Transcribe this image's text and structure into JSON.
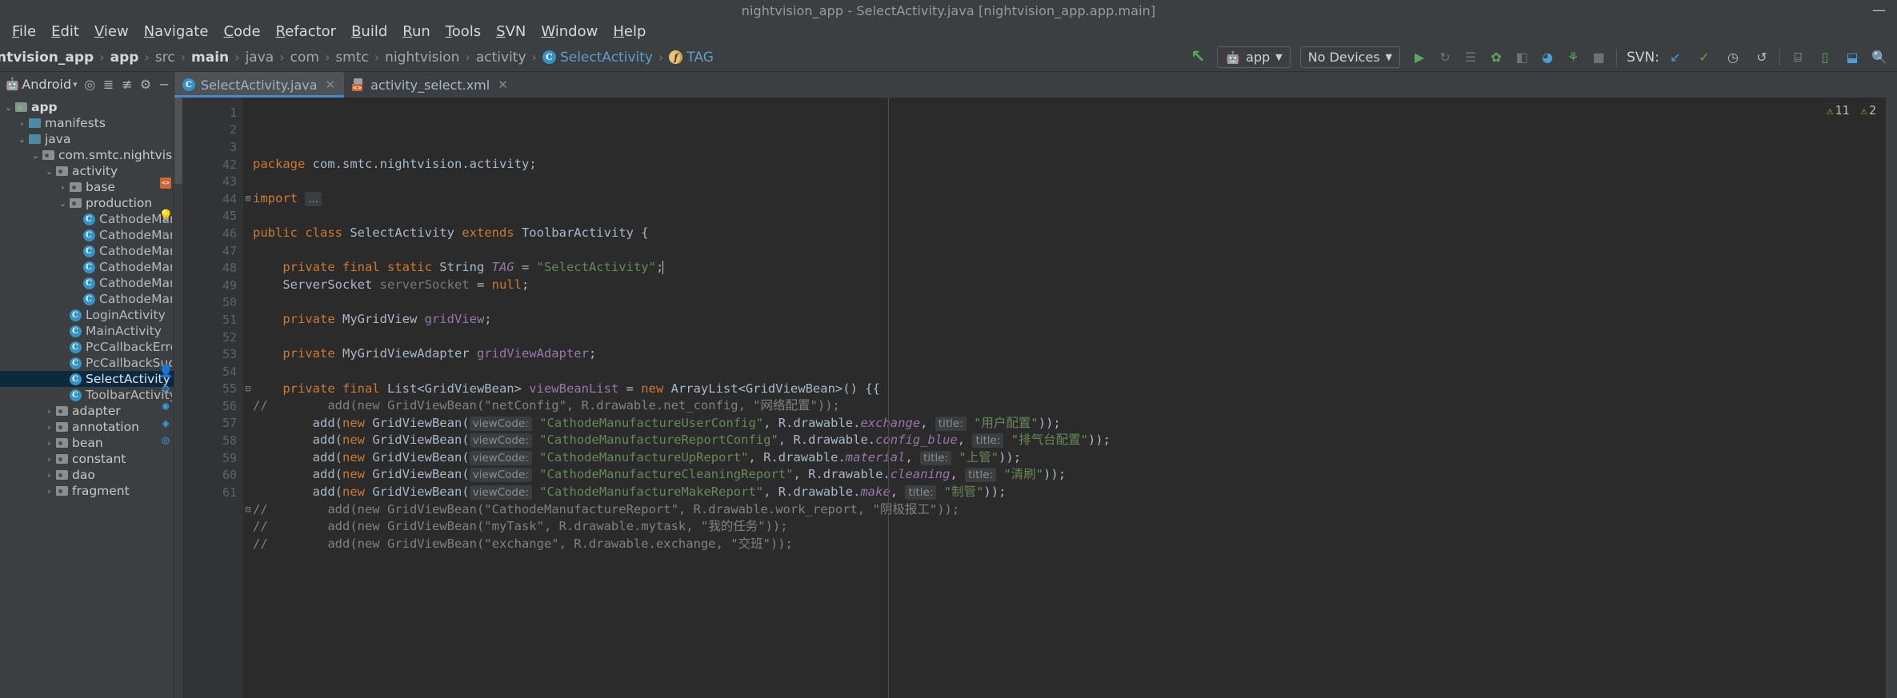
{
  "window": {
    "title": "nightvision_app - SelectActivity.java [nightvision_app.app.main]",
    "minimize": "—",
    "maximize": "❐",
    "close": "✕"
  },
  "menubar": {
    "items": [
      "File",
      "Edit",
      "View",
      "Navigate",
      "Code",
      "Refactor",
      "Build",
      "Run",
      "Tools",
      "SVN",
      "Window",
      "Help"
    ]
  },
  "breadcrumb": {
    "items": [
      {
        "label": "ntvision_app",
        "style": "bold"
      },
      {
        "label": "app",
        "style": "bold"
      },
      {
        "label": "src",
        "style": "normal"
      },
      {
        "label": "main",
        "style": "bold"
      },
      {
        "label": "java",
        "style": "normal"
      },
      {
        "label": "com",
        "style": "normal"
      },
      {
        "label": "smtc",
        "style": "normal"
      },
      {
        "label": "nightvision",
        "style": "normal"
      },
      {
        "label": "activity",
        "style": "normal"
      },
      {
        "label": "SelectActivity",
        "style": "link",
        "icon": "class-icon"
      },
      {
        "label": "TAG",
        "style": "link",
        "icon": "field-icon"
      }
    ],
    "separator": "›"
  },
  "toolbar": {
    "back_arrow": "↖",
    "run_config": {
      "label": "app",
      "icon": "android-icon",
      "caret": "▼"
    },
    "device_select": {
      "label": "No Devices",
      "caret": "▼"
    },
    "buttons": [
      {
        "name": "run-button",
        "glyph": "▶",
        "color": "#5ca75c"
      },
      {
        "name": "apply-changes-icon",
        "glyph": "↻",
        "color": "#6f7072"
      },
      {
        "name": "apply-code-changes-icon",
        "glyph": "☰",
        "color": "#6f7072"
      },
      {
        "name": "debug-icon",
        "glyph": "✿",
        "color": "#5ca75c"
      },
      {
        "name": "attach-debugger-icon",
        "glyph": "◧",
        "color": "#6f7072"
      },
      {
        "name": "profiler-icon",
        "glyph": "◕",
        "color": "#4a9fd4"
      },
      {
        "name": "run-with-coverage-icon",
        "glyph": "⚘",
        "color": "#5ca75c"
      },
      {
        "name": "stop-icon",
        "glyph": "■",
        "color": "#6f7072"
      }
    ],
    "svn_label": "SVN:",
    "svn_buttons": [
      {
        "name": "svn-update-icon",
        "glyph": "↙",
        "color": "#4a9fd4"
      },
      {
        "name": "svn-commit-icon",
        "glyph": "✓",
        "color": "#5ca75c"
      },
      {
        "name": "svn-history-icon",
        "glyph": "◷",
        "color": "#bbbbbb"
      },
      {
        "name": "svn-revert-icon",
        "glyph": "↺",
        "color": "#bbbbbb"
      }
    ],
    "right_buttons": [
      {
        "name": "avd-manager-icon",
        "glyph": "⌸",
        "color": "#a9b7c6"
      },
      {
        "name": "sdk-manager-icon",
        "glyph": "▯",
        "color": "#5ca75c"
      },
      {
        "name": "gradle-sync-icon",
        "glyph": "⬓",
        "color": "#4a9fd4"
      },
      {
        "name": "search-everywhere-icon",
        "glyph": "🔍",
        "color": "#a9b7c6"
      }
    ]
  },
  "sidebar": {
    "header": {
      "title": "Android",
      "caret": "▾",
      "icons": [
        "locate-icon",
        "collapse-all-icon",
        "expand-icon",
        "settings-icon",
        "hide-icon"
      ]
    },
    "tree": [
      {
        "indent": 0,
        "arrow": "⌄",
        "icon": "folder-module",
        "label": "app",
        "bold": true
      },
      {
        "indent": 1,
        "arrow": "›",
        "icon": "folder",
        "label": "manifests"
      },
      {
        "indent": 1,
        "arrow": "⌄",
        "icon": "folder",
        "label": "java"
      },
      {
        "indent": 2,
        "arrow": "⌄",
        "icon": "package",
        "label": "com.smtc.nightvision"
      },
      {
        "indent": 3,
        "arrow": "⌄",
        "icon": "package",
        "label": "activity"
      },
      {
        "indent": 4,
        "arrow": "›",
        "icon": "package",
        "label": "base"
      },
      {
        "indent": 4,
        "arrow": "⌄",
        "icon": "package",
        "label": "production"
      },
      {
        "indent": 5,
        "arrow": "",
        "icon": "class",
        "label": "CathodeManufac"
      },
      {
        "indent": 5,
        "arrow": "",
        "icon": "class",
        "label": "CathodeManufac"
      },
      {
        "indent": 5,
        "arrow": "",
        "icon": "class",
        "label": "CathodeManufac"
      },
      {
        "indent": 5,
        "arrow": "",
        "icon": "class",
        "label": "CathodeManufac"
      },
      {
        "indent": 5,
        "arrow": "",
        "icon": "class",
        "label": "CathodeManufac"
      },
      {
        "indent": 5,
        "arrow": "",
        "icon": "class",
        "label": "CathodeManufac"
      },
      {
        "indent": 4,
        "arrow": "",
        "icon": "class",
        "label": "LoginActivity"
      },
      {
        "indent": 4,
        "arrow": "",
        "icon": "class",
        "label": "MainActivity"
      },
      {
        "indent": 4,
        "arrow": "",
        "icon": "class",
        "label": "PcCallbackErrorActi"
      },
      {
        "indent": 4,
        "arrow": "",
        "icon": "class",
        "label": "PcCallbackSuccessA"
      },
      {
        "indent": 4,
        "arrow": "",
        "icon": "class",
        "label": "SelectActivity",
        "selected": true
      },
      {
        "indent": 4,
        "arrow": "",
        "icon": "class",
        "label": "ToolbarActivity"
      },
      {
        "indent": 3,
        "arrow": "›",
        "icon": "package",
        "label": "adapter"
      },
      {
        "indent": 3,
        "arrow": "›",
        "icon": "package",
        "label": "annotation"
      },
      {
        "indent": 3,
        "arrow": "›",
        "icon": "package",
        "label": "bean"
      },
      {
        "indent": 3,
        "arrow": "›",
        "icon": "package",
        "label": "constant"
      },
      {
        "indent": 3,
        "arrow": "›",
        "icon": "package",
        "label": "dao"
      },
      {
        "indent": 3,
        "arrow": "›",
        "icon": "package",
        "label": "fragment"
      }
    ]
  },
  "editor": {
    "tabs": [
      {
        "label": "SelectActivity.java",
        "icon": "java-class-icon",
        "active": true,
        "close": "✕"
      },
      {
        "label": "activity_select.xml",
        "icon": "xml-layout-icon",
        "active": false,
        "close": "✕"
      }
    ],
    "inspections": {
      "warnings": "11",
      "weak_warnings": "2",
      "warn_glyph": "⚠"
    },
    "line_numbers": [
      "1",
      "2",
      "3",
      "42",
      "43",
      "44",
      "45",
      "46",
      "47",
      "48",
      "49",
      "50",
      "51",
      "52",
      "53",
      "54",
      "55",
      "56",
      "57",
      "58",
      "59",
      "60",
      "61"
    ],
    "lines": [
      {
        "num": "1",
        "segments": [
          {
            "t": "package ",
            "c": "kw"
          },
          {
            "t": "com.smtc.nightvision.activity;",
            "c": "plain"
          }
        ]
      },
      {
        "num": "2",
        "segments": []
      },
      {
        "num": "3",
        "segments": [
          {
            "t": "import ",
            "c": "kw"
          },
          {
            "t": "...",
            "c": "hint-box"
          }
        ],
        "fold": "⊞"
      },
      {
        "num": "42",
        "segments": []
      },
      {
        "num": "43",
        "segments": [
          {
            "t": "public class ",
            "c": "kw"
          },
          {
            "t": "SelectActivity ",
            "c": "cls2"
          },
          {
            "t": "extends ",
            "c": "kw"
          },
          {
            "t": "ToolbarActivity {",
            "c": "cls2"
          }
        ],
        "gutter_icon": "layout-file-icon"
      },
      {
        "num": "44",
        "segments": []
      },
      {
        "num": "45",
        "segments": [
          {
            "t": "    ",
            "c": "plain"
          },
          {
            "t": "private final static ",
            "c": "kw"
          },
          {
            "t": "String ",
            "c": "cls2"
          },
          {
            "t": "TAG",
            "c": "stat"
          },
          {
            "t": " = ",
            "c": "plain"
          },
          {
            "t": "\"SelectActivity\"",
            "c": "str"
          },
          {
            "t": ";",
            "c": "plain"
          }
        ],
        "gutter_icon": "bulb-icon",
        "caret": true
      },
      {
        "num": "46",
        "segments": [
          {
            "t": "    ",
            "c": "plain"
          },
          {
            "t": "ServerSocket ",
            "c": "cls2"
          },
          {
            "t": "serverSocket",
            "c": "graytxt"
          },
          {
            "t": " = ",
            "c": "plain"
          },
          {
            "t": "null",
            "c": "kw"
          },
          {
            "t": ";",
            "c": "plain"
          }
        ],
        "gutter_icon": "run-arrow-icon"
      },
      {
        "num": "47",
        "segments": []
      },
      {
        "num": "48",
        "segments": [
          {
            "t": "    ",
            "c": "plain"
          },
          {
            "t": "private ",
            "c": "kw"
          },
          {
            "t": "MyGridView ",
            "c": "cls2"
          },
          {
            "t": "gridView",
            "c": "fld"
          },
          {
            "t": ";",
            "c": "plain"
          }
        ]
      },
      {
        "num": "49",
        "segments": []
      },
      {
        "num": "50",
        "segments": [
          {
            "t": "    ",
            "c": "plain"
          },
          {
            "t": "private ",
            "c": "kw"
          },
          {
            "t": "MyGridViewAdapter ",
            "c": "cls2"
          },
          {
            "t": "gridViewAdapter",
            "c": "fld"
          },
          {
            "t": ";",
            "c": "plain"
          }
        ]
      },
      {
        "num": "51",
        "segments": []
      },
      {
        "num": "52",
        "segments": [
          {
            "t": "    ",
            "c": "plain"
          },
          {
            "t": "private final ",
            "c": "kw"
          },
          {
            "t": "List<GridViewBean> ",
            "c": "cls2"
          },
          {
            "t": "viewBeanList",
            "c": "fld"
          },
          {
            "t": " = ",
            "c": "plain"
          },
          {
            "t": "new ",
            "c": "kw"
          },
          {
            "t": "ArrayList<GridViewBean>() {{",
            "c": "cls2"
          }
        ],
        "fold": "⊟"
      },
      {
        "num": "53",
        "segments": [
          {
            "t": "//        add(new GridViewBean(\"netConfig\", R.drawable.net_config, \"网络配置\"));",
            "c": "cmt"
          }
        ]
      },
      {
        "num": "54",
        "segments": [
          {
            "t": "        ",
            "c": "plain"
          },
          {
            "t": "add(",
            "c": "plain"
          },
          {
            "t": "new ",
            "c": "kw"
          },
          {
            "t": "GridViewBean(",
            "c": "plain"
          },
          {
            "t": "viewCode:",
            "c": "hint"
          },
          {
            "t": " \"CathodeManufactureUserConfig\"",
            "c": "str"
          },
          {
            "t": ", R.drawable.",
            "c": "plain"
          },
          {
            "t": "exchange",
            "c": "stat"
          },
          {
            "t": ", ",
            "c": "plain"
          },
          {
            "t": "title:",
            "c": "hint"
          },
          {
            "t": " \"用户配置\"",
            "c": "str"
          },
          {
            "t": "));",
            "c": "plain"
          }
        ],
        "gutter_icon": "user-config-icon"
      },
      {
        "num": "55",
        "segments": [
          {
            "t": "        ",
            "c": "plain"
          },
          {
            "t": "add(",
            "c": "plain"
          },
          {
            "t": "new ",
            "c": "kw"
          },
          {
            "t": "GridViewBean(",
            "c": "plain"
          },
          {
            "t": "viewCode:",
            "c": "hint"
          },
          {
            "t": " \"CathodeManufactureReportConfig\"",
            "c": "str"
          },
          {
            "t": ", R.drawable.",
            "c": "plain"
          },
          {
            "t": "config_blue",
            "c": "stat"
          },
          {
            "t": ", ",
            "c": "plain"
          },
          {
            "t": "title:",
            "c": "hint"
          },
          {
            "t": " \"排气台配置\"",
            "c": "str"
          },
          {
            "t": "));",
            "c": "plain"
          }
        ],
        "gutter_icon": "gear-blue-icon"
      },
      {
        "num": "56",
        "segments": [
          {
            "t": "        ",
            "c": "plain"
          },
          {
            "t": "add(",
            "c": "plain"
          },
          {
            "t": "new ",
            "c": "kw"
          },
          {
            "t": "GridViewBean(",
            "c": "plain"
          },
          {
            "t": "viewCode:",
            "c": "hint"
          },
          {
            "t": " \"CathodeManufactureUpReport\"",
            "c": "str"
          },
          {
            "t": ", R.drawable.",
            "c": "plain"
          },
          {
            "t": "material",
            "c": "stat"
          },
          {
            "t": ", ",
            "c": "plain"
          },
          {
            "t": "title:",
            "c": "hint"
          },
          {
            "t": " \"上管\"",
            "c": "str"
          },
          {
            "t": "));",
            "c": "plain"
          }
        ],
        "gutter_icon": "material-icon"
      },
      {
        "num": "57",
        "segments": [
          {
            "t": "        ",
            "c": "plain"
          },
          {
            "t": "add(",
            "c": "plain"
          },
          {
            "t": "new ",
            "c": "kw"
          },
          {
            "t": "GridViewBean(",
            "c": "plain"
          },
          {
            "t": "viewCode:",
            "c": "hint"
          },
          {
            "t": " \"CathodeManufactureCleaningReport\"",
            "c": "str"
          },
          {
            "t": ", R.drawable.",
            "c": "plain"
          },
          {
            "t": "cleaning",
            "c": "stat"
          },
          {
            "t": ", ",
            "c": "plain"
          },
          {
            "t": "title:",
            "c": "hint"
          },
          {
            "t": " \"清刷\"",
            "c": "str"
          },
          {
            "t": "));",
            "c": "plain"
          }
        ],
        "gutter_icon": "cleaning-icon"
      },
      {
        "num": "58",
        "segments": [
          {
            "t": "        ",
            "c": "plain"
          },
          {
            "t": "add(",
            "c": "plain"
          },
          {
            "t": "new ",
            "c": "kw"
          },
          {
            "t": "GridViewBean(",
            "c": "plain"
          },
          {
            "t": "viewCode:",
            "c": "hint"
          },
          {
            "t": " \"CathodeManufactureMakeReport\"",
            "c": "str"
          },
          {
            "t": ", R.drawable.",
            "c": "plain"
          },
          {
            "t": "make",
            "c": "stat"
          },
          {
            "t": ", ",
            "c": "plain"
          },
          {
            "t": "title:",
            "c": "hint"
          },
          {
            "t": " \"制管\"",
            "c": "str"
          },
          {
            "t": "));",
            "c": "plain"
          }
        ],
        "gutter_icon": "make-icon"
      },
      {
        "num": "59",
        "segments": [
          {
            "t": "//        add(new GridViewBean(\"CathodeManufactureReport\", R.drawable.work_report, \"阴极报工\"));",
            "c": "cmt"
          }
        ],
        "fold": "⊟"
      },
      {
        "num": "60",
        "segments": [
          {
            "t": "//        add(new GridViewBean(\"myTask\", R.drawable.mytask, \"我的任务\"));",
            "c": "cmt"
          }
        ]
      },
      {
        "num": "61",
        "segments": [
          {
            "t": "//        add(new GridViewBean(\"exchange\", R.drawable.exchange, \"交班\"));",
            "c": "cmt"
          }
        ]
      }
    ]
  }
}
